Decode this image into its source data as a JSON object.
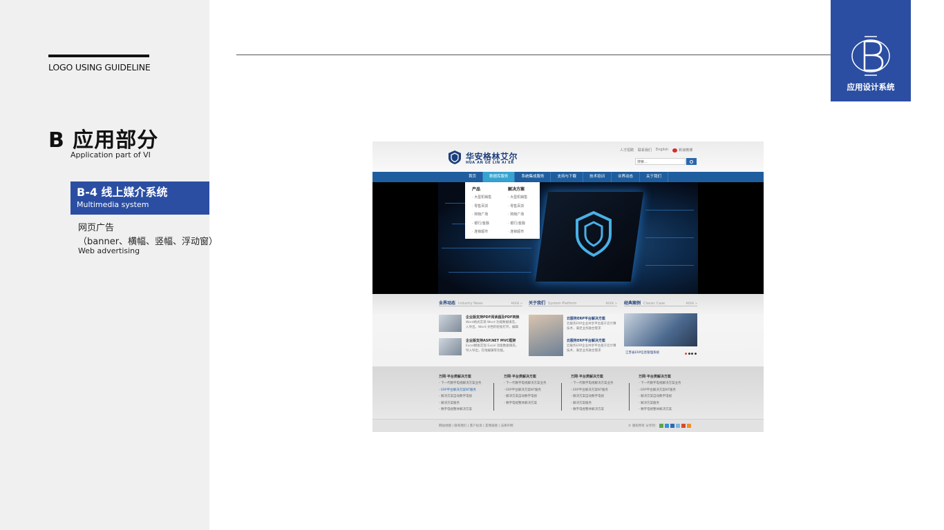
{
  "sidebar": {
    "guideline": "LOGO USING GUIDELINE",
    "section_title": "B 应用部分",
    "section_subtitle": "Application part of VI",
    "active_item": {
      "title": "B-4 线上媒介系统",
      "subtitle": "Multimedia system"
    },
    "sub_item": {
      "line1": "网页广告",
      "line2": "（banner、横幅、竖幅、浮动窗）",
      "line3": "Web advertising"
    }
  },
  "badge": {
    "label": "应用设计系统",
    "icon": "b-monogram-icon"
  },
  "colors": {
    "brand_blue": "#2b4ea2",
    "nav_blue": "#1f5e9e",
    "nav_active": "#36a3d0"
  },
  "site": {
    "brand": "华安格林艾尔",
    "brand_en": "HUA AN GE LIN AI ER",
    "top_links": [
      "人才招聘",
      "联系我们",
      "English"
    ],
    "weibo": "新浪微博",
    "search_placeholder": "搜索...",
    "nav": [
      "首页",
      "数据库服务",
      "系统集成服务",
      "支持与下载",
      "技术培训",
      "业界动态",
      "关于我们"
    ],
    "dropdown": {
      "col1": {
        "head": "产品",
        "items": [
          "大型机销售",
          "零售百货",
          "购物广场",
          "银行/金融",
          "连锁超市"
        ]
      },
      "col2": {
        "head": "解决方案",
        "items": [
          "大型机销售",
          "零售百货",
          "购物广场",
          "银行/金融",
          "连锁超市"
        ]
      }
    },
    "sections": [
      {
        "title": "业界动态",
        "title_en": "Industry News",
        "more": "MORE >"
      },
      {
        "title": "关于我们",
        "title_en": "System Platform",
        "more": "MORE >"
      },
      {
        "title": "经典案例",
        "title_en": "Classic Case",
        "more": "MORE >"
      }
    ],
    "news": [
      {
        "title": "企业版支持PDF阅读器及PDF转换",
        "desc1": "Word格式实现 Word 功能数据填充，",
        "desc2": "入导出，Word 文档的轻松打开，编辑"
      },
      {
        "title": "企业版支持ASP.NET MVC框架",
        "desc1": "Excel模板实现 Excel 功能数据填充，",
        "desc2": "导入导出，在线编辑等功能。"
      }
    ],
    "about": [
      {
        "title": "云服务ERP平台解决方案",
        "desc1": "云服务ERP企业共享平台基于云计算",
        "desc2": "技术，满足业务融合需求"
      },
      {
        "title": "云服务ERP平台解决方案",
        "desc1": "云服务ERP企业共享平台基于云计算",
        "desc2": "技术，满足业务融合需求"
      }
    ],
    "case_caption": "江苏省ERP信息管理系统",
    "bottom_cols": [
      {
        "head": "万网·平台类解决方案",
        "items": [
          "下一代数字电视解决方案业务",
          "ERP平台解决方案NT服务",
          "解决方案自动数字电视",
          "解决方案服务",
          "数字电视整体解决方案"
        ]
      },
      {
        "head": "万网·平台类解决方案",
        "items": [
          "下一代数字电视解决方案业务",
          "ERP平台解决方案NT服务",
          "解决方案自动数字电视",
          "数字电视整体解决方案"
        ]
      },
      {
        "head": "万网·平台类解决方案",
        "items": [
          "下一代数字电视解决方案业务",
          "ERP平台解决方案NT服务",
          "解决方案自动数字电视",
          "解决方案服务",
          "数字电视整体解决方案"
        ]
      },
      {
        "head": "万网·平台类解决方案",
        "items": [
          "下一代数字电视解决方案业务",
          "ERP平台解决方案NT服务",
          "解决方案自动数字电视",
          "解决方案服务",
          "数字电视整体解决方案"
        ]
      }
    ],
    "footer_links": "网站地图 | 联系我们 | 客户投诉 | 友情链接 | 法律声明",
    "footer_share": "© 版权所有 分享到："
  }
}
